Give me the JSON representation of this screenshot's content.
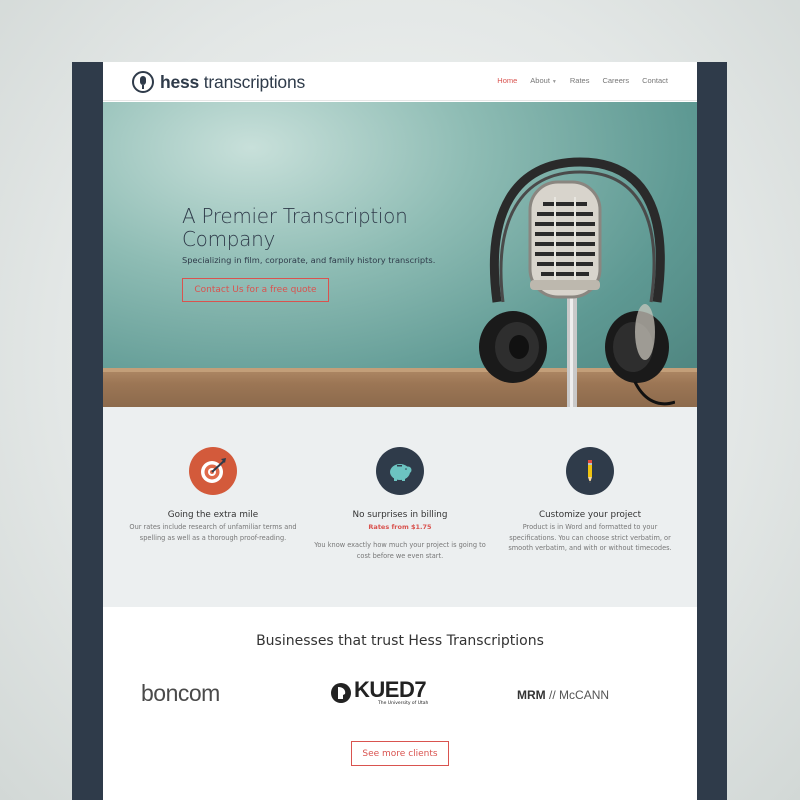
{
  "brand": {
    "name_bold": "hess",
    "name_light": "transcriptions"
  },
  "nav": {
    "items": [
      {
        "label": "Home",
        "active": true
      },
      {
        "label": "About",
        "has_dropdown": true
      },
      {
        "label": "Rates"
      },
      {
        "label": "Careers"
      },
      {
        "label": "Contact"
      }
    ]
  },
  "hero": {
    "title": "A Premier Transcription Company",
    "subtitle": "Specializing in film, corporate, and family history transcripts.",
    "cta_label": "Contact Us for a free quote"
  },
  "features": [
    {
      "icon": "target-icon",
      "title": "Going the extra mile",
      "highlight": "",
      "description": "Our rates include research of unfamiliar terms and spelling as well as a thorough proof-reading."
    },
    {
      "icon": "piggy-bank-icon",
      "title": "No surprises in billing",
      "highlight": "Rates from $1.75",
      "description": "You know exactly how much your project is going to cost before we even start."
    },
    {
      "icon": "pencil-icon",
      "title": "Customize your project",
      "highlight": "",
      "description": "Product is in Word and formatted to your specifications. You can choose strict verbatim, or smooth verbatim, and with or without timecodes."
    }
  ],
  "clients": {
    "title": "Businesses that trust Hess Transcriptions",
    "logos": [
      {
        "text": "boncom"
      },
      {
        "text": "KUED7",
        "subtext": "The University of Utah"
      },
      {
        "text_bold": "MRM",
        "separator": "//",
        "text_light": "McCANN"
      }
    ],
    "more_label": "See more clients"
  },
  "colors": {
    "accent": "#d9534f",
    "frame": "#2f3b4a",
    "feature_bg": "#eceff0",
    "target_bg": "#d35a3b",
    "icon_dark_bg": "#2f3b4a"
  }
}
